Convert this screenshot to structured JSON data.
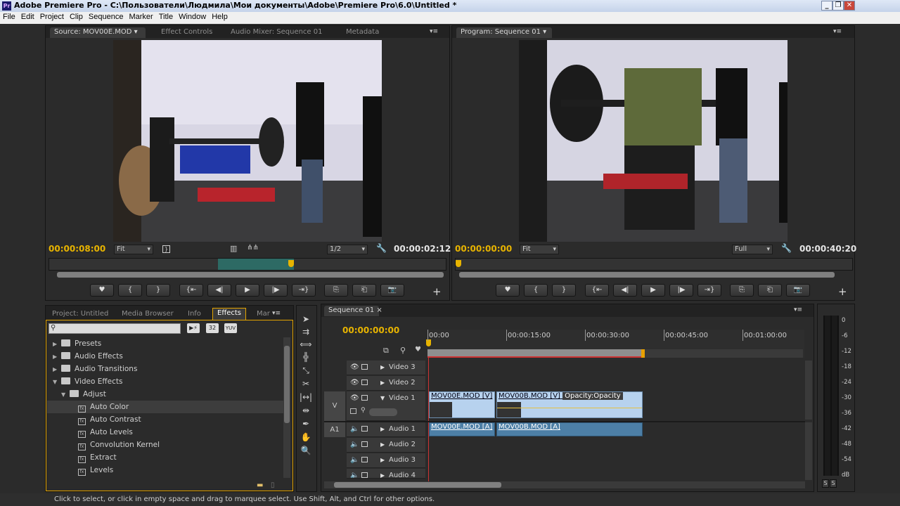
{
  "window": {
    "title": "Adobe Premiere Pro - C:\\Пользователи\\Людмила\\Мои документы\\Adobe\\Premiere Pro\\6.0\\Untitled *",
    "app_icon": "Pr"
  },
  "menu": [
    "File",
    "Edit",
    "Project",
    "Clip",
    "Sequence",
    "Marker",
    "Title",
    "Window",
    "Help"
  ],
  "source": {
    "tabs": [
      "Source: MOV00E.MOD",
      "Effect Controls",
      "Audio Mixer: Sequence 01",
      "Metadata"
    ],
    "timecode_current": "00:00:08:00",
    "fit": "Fit",
    "resolution": "1/2",
    "duration": "00:00:02:12",
    "playhead_fraction": 0.61
  },
  "program": {
    "tabs": [
      "Program: Sequence 01"
    ],
    "timecode_current": "00:00:00:00",
    "fit": "Fit",
    "resolution": "Full",
    "duration": "00:00:40:20"
  },
  "transport": {
    "source_buttons": [
      "♥",
      "{",
      "}",
      "{⇤",
      "◀|",
      "▶",
      "|▶",
      "⇥}",
      "⎘",
      "⎗",
      "📷"
    ],
    "program_buttons": [
      "♥",
      "{",
      "}",
      "{⇤",
      "◀|",
      "▶",
      "|▶",
      "⇥}",
      "⎘",
      "⎗",
      "📷"
    ],
    "add": "+"
  },
  "effects_panel": {
    "tabs": [
      "Project: Untitled",
      "Media Browser",
      "Info",
      "Effects",
      "Mar"
    ],
    "search_placeholder": "",
    "badges": [
      "32",
      "YUV"
    ],
    "items": [
      {
        "label": "Presets",
        "type": "folder",
        "level": 0
      },
      {
        "label": "Audio Effects",
        "type": "folder",
        "level": 0
      },
      {
        "label": "Audio Transitions",
        "type": "folder",
        "level": 0
      },
      {
        "label": "Video Effects",
        "type": "folder",
        "level": 0,
        "open": true
      },
      {
        "label": "Adjust",
        "type": "folder",
        "level": 1,
        "open": true
      },
      {
        "label": "Auto Color",
        "type": "effect",
        "level": 2,
        "selected": true
      },
      {
        "label": "Auto Contrast",
        "type": "effect",
        "level": 2
      },
      {
        "label": "Auto Levels",
        "type": "effect",
        "level": 2
      },
      {
        "label": "Convolution Kernel",
        "type": "effect",
        "level": 2
      },
      {
        "label": "Extract",
        "type": "effect",
        "level": 2
      },
      {
        "label": "Levels",
        "type": "effect",
        "level": 2
      }
    ]
  },
  "tools": [
    "select-tool",
    "track-select-tool",
    "ripple-edit-tool",
    "rolling-edit-tool",
    "rate-stretch-tool",
    "razor-tool",
    "slip-tool",
    "slide-tool",
    "pen-tool",
    "hand-tool",
    "zoom-tool"
  ],
  "timeline": {
    "tab": "Sequence 01",
    "timecode": "00:00:00:00",
    "ruler_labels": [
      "00:00",
      "00:00:15:00",
      "00:00:30:00",
      "00:00:45:00",
      "00:01:00:00"
    ],
    "tracks": {
      "video": [
        "Video 3",
        "Video 2",
        "Video 1"
      ],
      "audio": [
        "Audio 1",
        "Audio 2",
        "Audio 3",
        "Audio 4"
      ]
    },
    "source_patch_v": "V",
    "source_patch_a": "A1",
    "clips": {
      "video1": [
        "MOV00E.MOD [V]",
        "MOV00B.MOD [V]"
      ],
      "opacity": "Opacity:Opacity",
      "audio1": [
        "MOV00E.MOD [A]",
        "MOV00B.MOD [A]"
      ]
    }
  },
  "meters": {
    "labels": [
      "0",
      "-6",
      "-12",
      "-18",
      "-24",
      "-30",
      "-36",
      "-42",
      "-48",
      "-54",
      "dB"
    ],
    "solo": [
      "S",
      "S"
    ]
  },
  "status": "Click to select, or click in empty space and drag to marquee select. Use Shift, Alt, and Ctrl for other options."
}
